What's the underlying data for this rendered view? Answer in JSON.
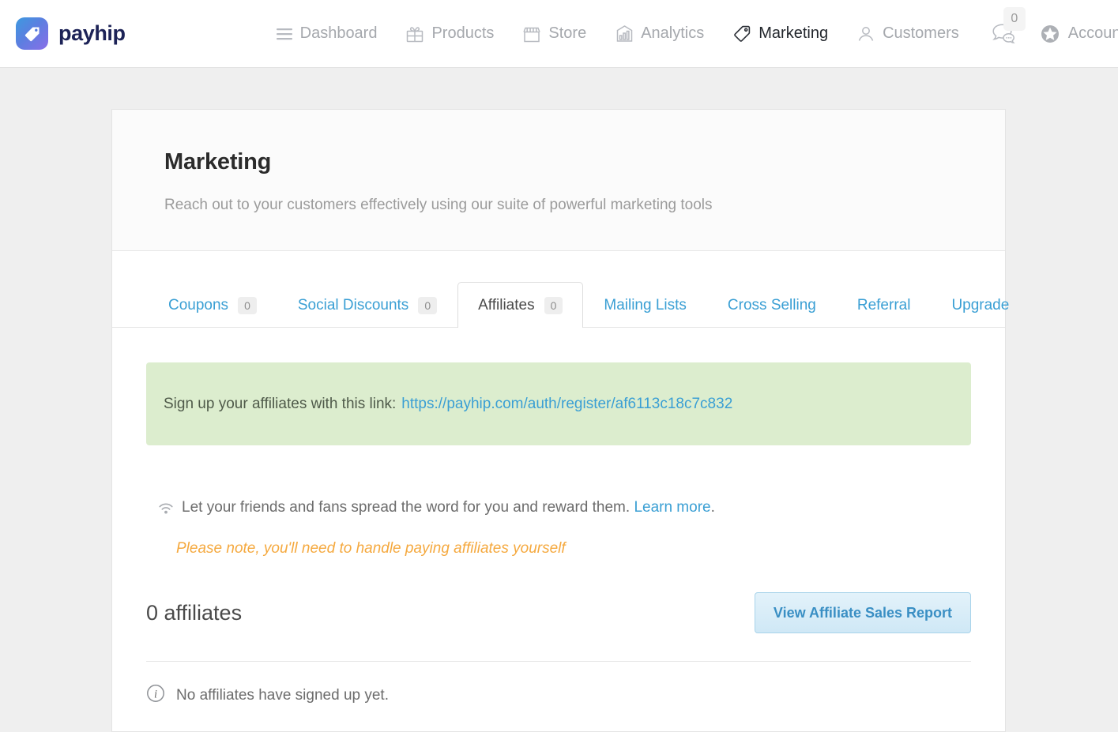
{
  "brand": {
    "name": "payhip",
    "logo_icon": "tag-heart-icon"
  },
  "nav": {
    "items": [
      {
        "label": "Dashboard",
        "icon": "hamburger-icon",
        "active": false
      },
      {
        "label": "Products",
        "icon": "gift-box-icon",
        "active": false
      },
      {
        "label": "Store",
        "icon": "storefront-icon",
        "active": false
      },
      {
        "label": "Analytics",
        "icon": "bar-chart-icon",
        "active": false
      },
      {
        "label": "Marketing",
        "icon": "price-tag-icon",
        "active": true
      },
      {
        "label": "Customers",
        "icon": "person-icon",
        "active": false
      }
    ],
    "messages": {
      "icon": "chat-bubbles-icon",
      "badge": "0"
    },
    "account": {
      "label": "Account",
      "icon": "star-badge-icon",
      "caret": "⌄"
    }
  },
  "header": {
    "title": "Marketing",
    "subtitle": "Reach out to your customers effectively using our suite of powerful marketing tools"
  },
  "tabs": [
    {
      "label": "Coupons",
      "badge": "0",
      "active": false
    },
    {
      "label": "Social Discounts",
      "badge": "0",
      "active": false
    },
    {
      "label": "Affiliates",
      "badge": "0",
      "active": true
    },
    {
      "label": "Mailing Lists",
      "badge": "",
      "active": false
    },
    {
      "label": "Cross Selling",
      "badge": "",
      "active": false
    },
    {
      "label": "Referral",
      "badge": "",
      "active": false
    },
    {
      "label": "Upgrade",
      "badge": "",
      "active": false
    }
  ],
  "affiliates": {
    "signup_banner": {
      "text": "Sign up your affiliates with this link:",
      "link_text": "https://payhip.com/auth/register/af6113c18c7c832"
    },
    "blurb": {
      "icon": "broadcast-signal-icon",
      "text": "Let your friends and fans spread the word for you and reward them.",
      "link_text": "Learn more",
      "trailing": "."
    },
    "note": "Please note, you'll need to handle paying affiliates yourself",
    "count_label": "0 affiliates",
    "report_button": "View Affiliate Sales Report",
    "empty_state": {
      "icon": "info-circle-icon",
      "text": "No affiliates have signed up yet."
    }
  },
  "colors": {
    "link_blue": "#3a9fd4",
    "banner_green": "#dcedce",
    "note_orange": "#f5a93f",
    "page_bg": "#efefef",
    "brand_navy": "#1d2357"
  }
}
